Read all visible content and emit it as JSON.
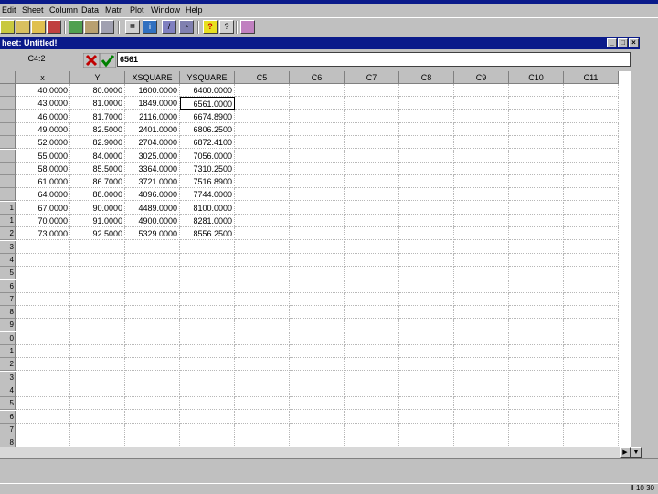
{
  "menu": [
    "Edit",
    "Sheet",
    "Column",
    "Data",
    "Matr",
    "Plot",
    "Window",
    "Help"
  ],
  "window": {
    "title": "heet: Untitled!"
  },
  "editline": {
    "cell_ref": "C4:2",
    "value": "6561"
  },
  "columns": [
    "x",
    "Y",
    "XSQUARE",
    "YSQUARE",
    "C5",
    "C6",
    "C7",
    "C8",
    "C9",
    "C10",
    "C11"
  ],
  "rows": [
    [
      "40.0000",
      "80.0000",
      "1600.0000",
      "6400.0000"
    ],
    [
      "43.0000",
      "81.0000",
      "1849.0000",
      "6561.0000"
    ],
    [
      "46.0000",
      "81.7000",
      "2116.0000",
      "6674.8900"
    ],
    [
      "49.0000",
      "82.5000",
      "2401.0000",
      "6806.2500"
    ],
    [
      "52.0000",
      "82.9000",
      "2704.0000",
      "6872.4100"
    ],
    [
      "55.0000",
      "84.0000",
      "3025.0000",
      "7056.0000"
    ],
    [
      "58.0000",
      "85.5000",
      "3364.0000",
      "7310.2500"
    ],
    [
      "61.0000",
      "86.7000",
      "3721.0000",
      "7516.8900"
    ],
    [
      "64.0000",
      "88.0000",
      "4096.0000",
      "7744.0000"
    ],
    [
      "67.0000",
      "90.0000",
      "4489.0000",
      "8100.0000"
    ],
    [
      "70.0000",
      "91.0000",
      "4900.0000",
      "8281.0000"
    ],
    [
      "73.0000",
      "92.5000",
      "5329.0000",
      "8556.2500"
    ]
  ],
  "row_labels": [
    "",
    "",
    "",
    "",
    "",
    "",
    "",
    "",
    "",
    "1",
    "1",
    "2",
    "3",
    "4",
    "5",
    "6",
    "7",
    "8",
    "9",
    "0",
    "1",
    "2",
    "3",
    "4",
    "5",
    "6",
    "7",
    "8"
  ],
  "active_cell": {
    "row": 1,
    "col": 3
  },
  "status": {
    "text": "Ⅱ 10 30"
  },
  "icons": [
    "open-icon",
    "edit-icon",
    "save-icon",
    "import-icon",
    "chart-icon",
    "print-icon",
    "data-icon",
    "info-icon",
    "pencil-icon",
    "plot-icon",
    "help-icon",
    "context-help-icon",
    "draw-icon"
  ]
}
